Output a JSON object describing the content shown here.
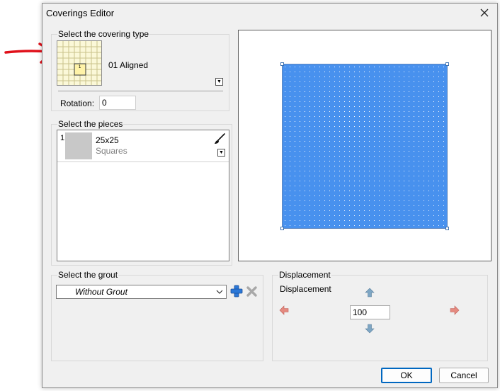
{
  "window": {
    "title": "Coverings Editor"
  },
  "covering_type": {
    "group_label": "Select the covering type",
    "selected_name": "01 Aligned",
    "rotation_label": "Rotation:",
    "rotation_value": "0",
    "thumb_tile_label": "1"
  },
  "pieces": {
    "group_label": "Select the pieces",
    "items": [
      {
        "number": "1",
        "name": "25x25",
        "type": "Squares",
        "color": "#c8c8c8"
      }
    ]
  },
  "grout": {
    "group_label": "Select the grout",
    "selected": "Without Grout"
  },
  "displacement": {
    "group_label": "Displacement",
    "label": "Displacement",
    "value": "100"
  },
  "buttons": {
    "ok": "OK",
    "cancel": "Cancel"
  },
  "colors": {
    "preview_fill": "#4891ee",
    "annotation_arrow": "#e0101a",
    "accent": "#0067c0"
  }
}
